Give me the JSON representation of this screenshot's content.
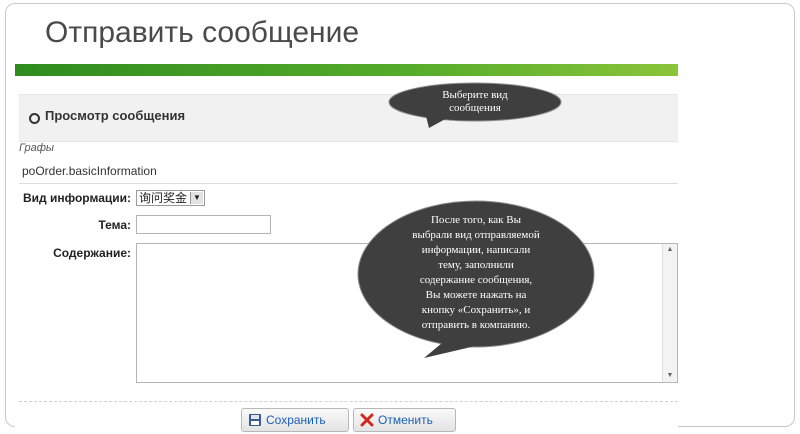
{
  "slide": {
    "title": "Отправить сообщение"
  },
  "form": {
    "view_title": "Просмотр сообщения",
    "graphs_label": "Графы",
    "basic_information": "poOrder.basicInformation",
    "info_type_label": "Вид информации:",
    "info_type_value": "询问奖金",
    "subject_label": "Тема:",
    "subject_value": "",
    "content_label": "Содержание:",
    "content_value": ""
  },
  "buttons": {
    "save_label": "Сохранить",
    "cancel_label": "Отменить"
  },
  "callouts": {
    "top_lines": [
      "Выберите вид",
      "сообщения"
    ],
    "main_lines": [
      "После того, как Вы",
      "выбрали вид отправляемой",
      "информации, написали",
      "тему, заполнили",
      "содержание сообщения,",
      "Вы можете нажать на",
      "кнопку «Сохранить», и",
      "отправить в компанию."
    ]
  },
  "colors": {
    "accent_green": "#56ac2a",
    "button_text": "#1a5fb4",
    "callout_fill": "#3f3f3f"
  }
}
